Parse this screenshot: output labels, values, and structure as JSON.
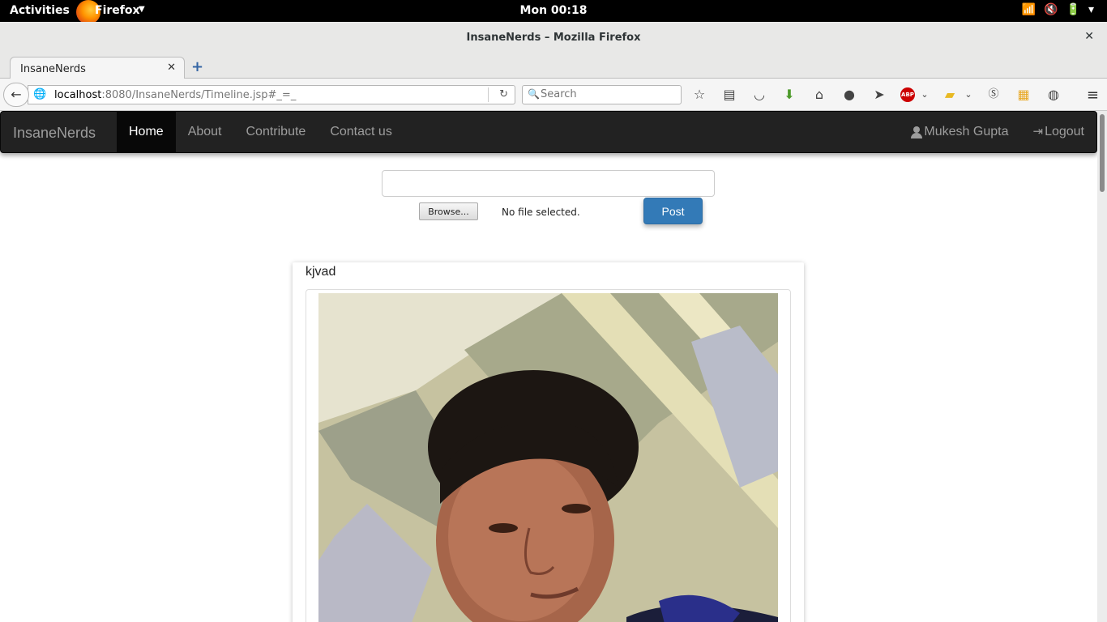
{
  "desktop": {
    "activities": "Activities",
    "app_name": "Firefox",
    "clock": "Mon 00:18"
  },
  "window": {
    "title": "InsaneNerds – Mozilla Firefox"
  },
  "tabs": [
    {
      "label": "InsaneNerds"
    }
  ],
  "urlbar": {
    "host": "localhost",
    "rest": ":8080/InsaneNerds/Timeline.jsp#_=_"
  },
  "search": {
    "placeholder": "Search"
  },
  "site": {
    "brand": "InsaneNerds",
    "nav": [
      {
        "label": "Home",
        "active": true
      },
      {
        "label": "About"
      },
      {
        "label": "Contribute"
      },
      {
        "label": "Contact us"
      }
    ],
    "user_name": "Mukesh Gupta",
    "logout_label": "Logout"
  },
  "composer": {
    "browse_label": "Browse...",
    "file_status": "No file selected.",
    "post_label": "Post"
  },
  "posts": [
    {
      "text": "kjvad"
    }
  ]
}
